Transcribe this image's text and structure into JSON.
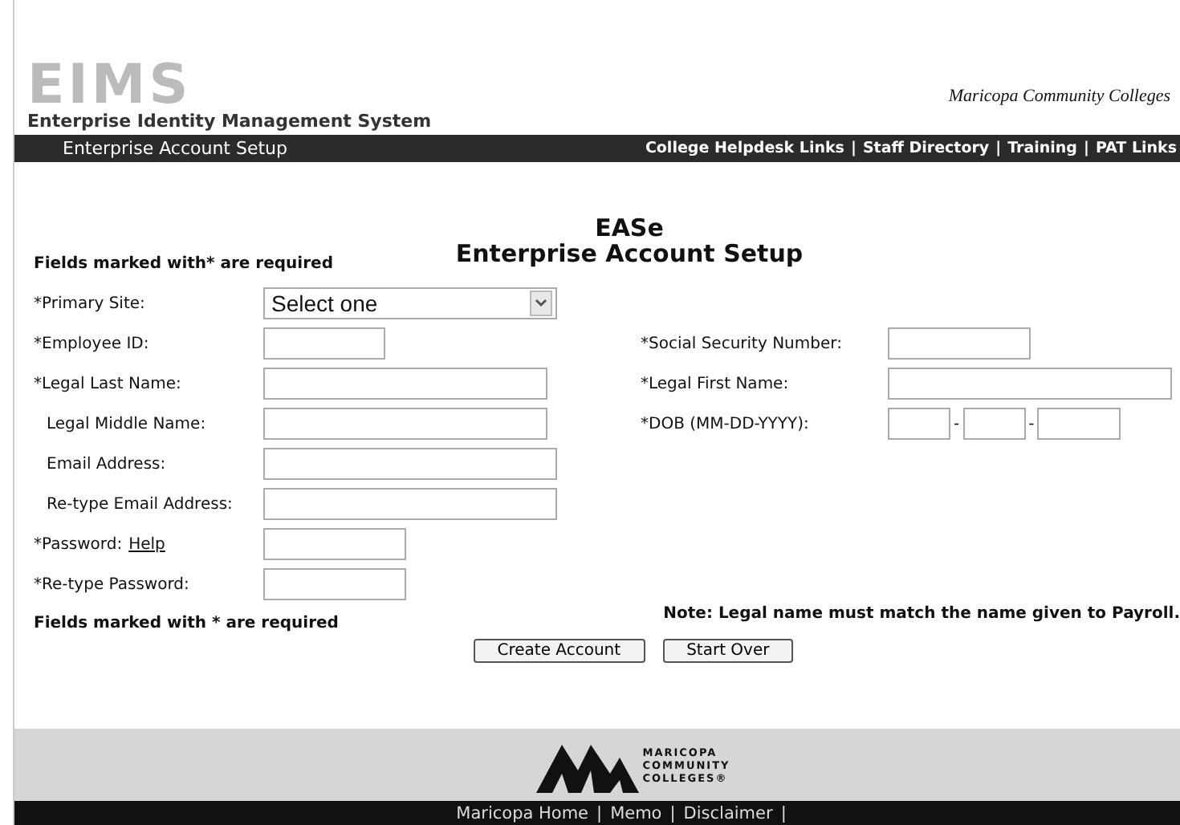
{
  "header": {
    "logo": "EIMS",
    "logo_subtitle": "Enterprise Identity Management System",
    "college": "Maricopa Community Colleges"
  },
  "nav_bar": {
    "title": "Enterprise Account Setup",
    "links": [
      "College Helpdesk Links",
      "Staff Directory",
      "Training",
      "PAT Links"
    ],
    "separator": "|"
  },
  "page_title": {
    "short": "EASe",
    "long": "Enterprise Account Setup"
  },
  "required_note_top": "Fields marked with* are required",
  "left_fields": [
    {
      "label": "*Primary Site:",
      "required": true,
      "kind": "select",
      "value": "Select one"
    },
    {
      "label": "*Employee ID:",
      "required": true,
      "kind": "short"
    },
    {
      "label": "*Legal Last Name:",
      "required": true,
      "kind": "long"
    },
    {
      "label": "Legal Middle Name:",
      "required": false,
      "kind": "long"
    },
    {
      "label": "Email Address:",
      "required": false,
      "kind": "wide"
    },
    {
      "label": "Re-type Email Address:",
      "required": false,
      "kind": "wide"
    },
    {
      "label": "*Password:",
      "required": true,
      "kind": "medium",
      "link": "Help"
    },
    {
      "label": "*Re-type Password:",
      "required": true,
      "kind": "medium"
    }
  ],
  "right_fields": [
    {
      "label": "*Social Security Number:",
      "kind": "medium"
    },
    {
      "label": "*Legal First Name:",
      "kind": "long"
    },
    {
      "label": "*DOB (MM-DD-YYYY):",
      "kind": "date",
      "separator": "-"
    }
  ],
  "required_note_bottom": "Fields marked with * are required",
  "payroll_note": "Note: Legal name must match the name given to Payroll.",
  "buttons": [
    "Create Account",
    "Start Over"
  ],
  "footer": {
    "logo_lines": [
      "MARICOPA",
      "COMMUNITY",
      "COLLEGES®"
    ],
    "links": [
      "Maricopa Home",
      "Memo",
      "Disclaimer"
    ],
    "separator": "|"
  }
}
